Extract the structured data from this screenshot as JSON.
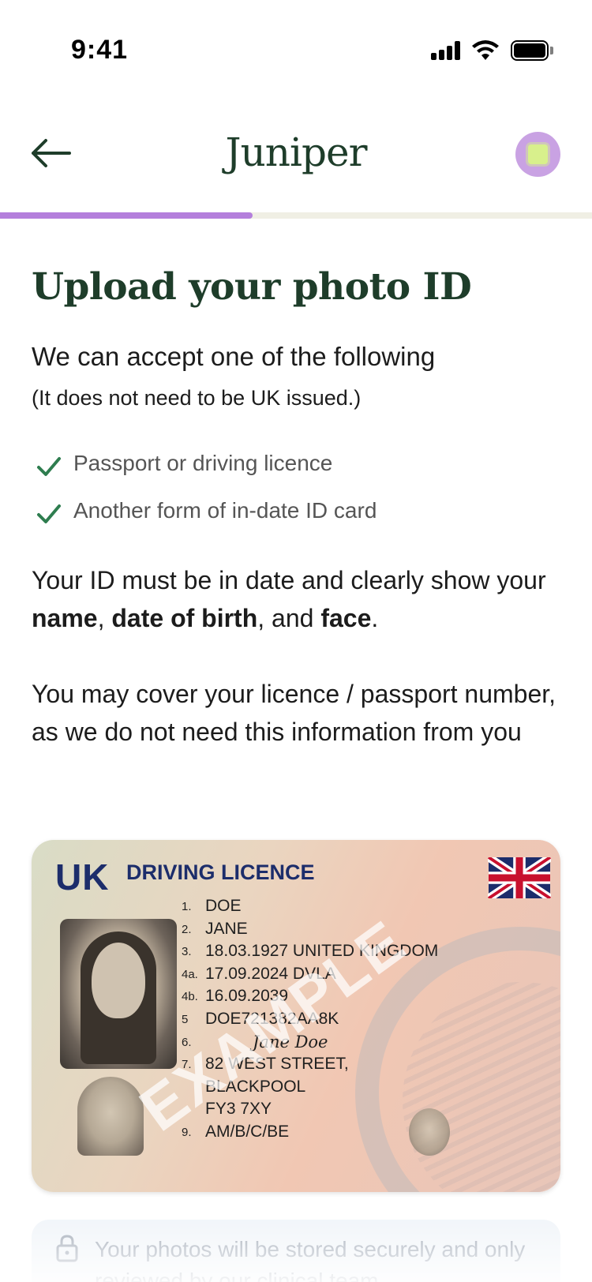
{
  "status_bar": {
    "time": "9:41"
  },
  "header": {
    "logo": "Juniper",
    "avatar_color": "#c9a2e3"
  },
  "progress": {
    "value": 0.427,
    "color": "#b47fdc"
  },
  "content": {
    "title": "Upload your photo ID",
    "subtitle": "We can accept one of the following",
    "note": "(It does not need to be UK issued.)",
    "checklist": [
      "Passport or driving licence",
      "Another form of in-date ID card"
    ],
    "para1": {
      "t1": "Your ID must be in date and clearly show your ",
      "b1": "name",
      "t2": ", ",
      "b2": "date of birth",
      "t3": ", and ",
      "b3": "face",
      "t4": "."
    },
    "para2": "You may cover your licence / passport number, as we do not need this information from you"
  },
  "id_card": {
    "country": "UK",
    "type": "DRIVING LICENCE",
    "watermark": "EXAMPLE",
    "fields": [
      {
        "num": "1.",
        "value": "DOE"
      },
      {
        "num": "2.",
        "value": "JANE"
      },
      {
        "num": "3.",
        "value": "18.03.1927  UNITED KINGDOM"
      },
      {
        "num": "4a.",
        "value": "17.09.2024  DVLA"
      },
      {
        "num": "4b.",
        "value": "16.09.2039"
      },
      {
        "num": "5",
        "value": "DOE721382AA8K"
      },
      {
        "num": "6.",
        "value": "Jane Doe"
      },
      {
        "num": "7.",
        "value": "82 WEST STREET,"
      },
      {
        "num": "",
        "value": "BLACKPOOL"
      },
      {
        "num": "",
        "value": "FY3 7XY"
      },
      {
        "num": "9.",
        "value": "AM/B/C/BE"
      }
    ]
  },
  "secure_note": "Your photos will be stored securely and only reviewed by our clinical team.",
  "colors": {
    "brand_green": "#1e3d2a",
    "check_green": "#2e7d4f",
    "accent_purple": "#b47fdc"
  }
}
